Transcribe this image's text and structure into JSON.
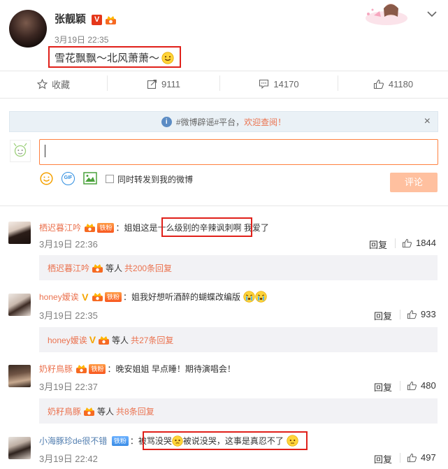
{
  "post": {
    "username": "张靓颖",
    "time": "3月19日 22:35",
    "text": "雪花飘飘～北风萧萧～",
    "v_label": "V"
  },
  "toolbar": {
    "favorite": "收藏",
    "repost_count": "9111",
    "comment_count": "14170",
    "like_count": "41180"
  },
  "notice": {
    "text_plain": "#微博辟谣#平台，",
    "text_link": "欢迎查阅！",
    "close": "×"
  },
  "composer": {
    "sync_label": "同时转发到我的微博",
    "submit_label": "评论",
    "gif_label": "GIF"
  },
  "comments": [
    {
      "name": "栖迟暮江吟",
      "badge": "铁粉",
      "text_before": "：姐姐这是",
      "text_highlight": "十么级别的辛辣讽刺啊",
      "text_after": " 我爱了",
      "time": "3月19日 22:36",
      "reply_label": "回复",
      "likes": "1844",
      "sub_name": "栖迟暮江吟",
      "sub_mid": "等人",
      "sub_count": "共200条回复"
    },
    {
      "name": "honey嫒诶",
      "v_label": "V",
      "badge": "铁粉",
      "text": "：姐我好想听酒醉的蝴蝶改编版",
      "time": "3月19日 22:35",
      "reply_label": "回复",
      "likes": "933",
      "sub_name": "honey嫒诶",
      "sub_v": "V",
      "sub_mid": "等人",
      "sub_count": "共27条回复"
    },
    {
      "name": "奶籽鳥豚",
      "badge": "铁粉",
      "text": "：晚安姐姐 早点睡！期待演唱会！",
      "time": "3月19日 22:37",
      "reply_label": "回复",
      "likes": "480",
      "sub_name": "奶籽鳥豚",
      "sub_mid": "等人",
      "sub_count": "共8条回复"
    },
    {
      "name": "小海豚珍de很不错",
      "badge": "铁粉",
      "text_prefix": "：",
      "text_highlight_a": "被骂没哭",
      "text_highlight_b": "被说没哭，这事是真忍不了",
      "time": "3月19日 22:42",
      "reply_label": "回复",
      "likes": "497"
    }
  ]
}
